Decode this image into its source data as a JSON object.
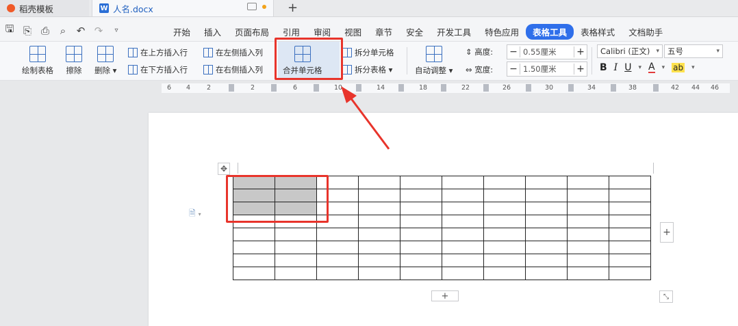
{
  "tabs": [
    {
      "label": "稻壳模板"
    },
    {
      "label": "人名.docx"
    }
  ],
  "menus": [
    "开始",
    "插入",
    "页面布局",
    "引用",
    "审阅",
    "视图",
    "章节",
    "安全",
    "开发工具",
    "特色应用",
    "表格工具",
    "表格样式",
    "文档助手"
  ],
  "active_menu": "表格工具",
  "ribbon": {
    "draw_table": "绘制表格",
    "eraser": "擦除",
    "delete": "删除",
    "insert_above": "在上方插入行",
    "insert_below": "在下方插入行",
    "insert_left": "在左侧插入列",
    "insert_right": "在右侧插入列",
    "merge_cells": "合并单元格",
    "split_cells": "拆分单元格",
    "split_table": "拆分表格",
    "auto_fit": "自动调整",
    "height_label": "高度:",
    "height_value": "0.55厘米",
    "width_label": "宽度:",
    "width_value": "1.50厘米",
    "font_name": "Calibri (正文)",
    "font_size": "五号",
    "bold": "B",
    "italic": "I",
    "underline": "U",
    "font_color": "A",
    "highlight": "ab"
  },
  "ruler_ticks": [
    "6",
    "4",
    "2",
    "2",
    "6",
    "10",
    "14",
    "18",
    "22",
    "26",
    "30",
    "34",
    "38",
    "42",
    "44",
    "46"
  ],
  "table": {
    "rows": 8,
    "cols": 10,
    "selected_rows": 3,
    "selected_cols": 2
  },
  "colors": {
    "accent": "#2f6fea",
    "highlight_red": "#e8342b",
    "selection": "#c8c8c8"
  }
}
